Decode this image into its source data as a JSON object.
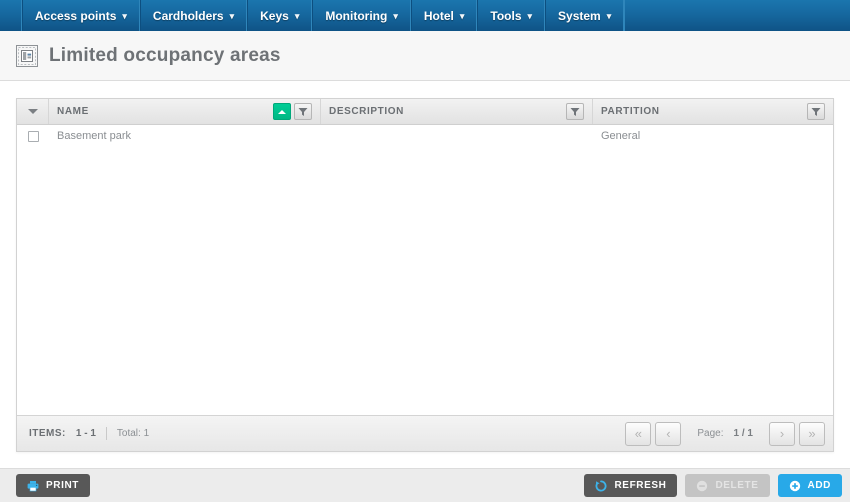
{
  "nav": {
    "items": [
      {
        "label": "Access points",
        "caret": "chevron-down-icon"
      },
      {
        "label": "Cardholders",
        "caret": "chevron-down-icon"
      },
      {
        "label": "Keys",
        "caret": "chevron-down-icon"
      },
      {
        "label": "Monitoring",
        "caret": "chevron-down-icon"
      },
      {
        "label": "Hotel",
        "caret": "chevron-down-icon"
      },
      {
        "label": "Tools",
        "caret": "chevron-down-icon"
      },
      {
        "label": "System",
        "caret": "chevron-down-icon"
      }
    ],
    "caret_glyph": "▾"
  },
  "header": {
    "title": "Limited occupancy areas",
    "icon": "limited-occupancy-area-icon"
  },
  "grid": {
    "columns": [
      {
        "key": "select",
        "label": "",
        "icon": "chevron-down-icon"
      },
      {
        "key": "name",
        "label": "NAME",
        "sorted": true,
        "sort_direction": "asc",
        "filter_icon": "funnel-icon"
      },
      {
        "key": "description",
        "label": "DESCRIPTION",
        "sorted": false,
        "filter_icon": "funnel-icon"
      },
      {
        "key": "partition",
        "label": "PARTITION",
        "sorted": false,
        "filter_icon": "funnel-icon"
      }
    ],
    "rows": [
      {
        "selected": false,
        "name": "Basement park",
        "description": "",
        "partition": "General"
      }
    ],
    "footer": {
      "items_label": "ITEMS:",
      "items_range": "1 - 1",
      "total_label": "Total: 1",
      "page_label": "Page:",
      "page_value": "1 / 1",
      "first_glyph": "«",
      "prev_glyph": "‹",
      "next_glyph": "›",
      "last_glyph": "»"
    }
  },
  "toolbar": {
    "print_label": "PRINT",
    "print_icon": "printer-icon",
    "refresh_label": "REFRESH",
    "refresh_icon": "refresh-icon",
    "delete_label": "DELETE",
    "delete_icon": "minus-circle-icon",
    "delete_disabled": true,
    "add_label": "ADD",
    "add_icon": "plus-circle-icon"
  },
  "colors": {
    "nav_blue": "#16689f",
    "accent_blue": "#28a9e8",
    "sort_green": "#00c48c",
    "dark_button": "#585858",
    "disabled_gray": "#c4c4c4",
    "title_text": "#6e7276",
    "page_bg": "#ffffff",
    "toolbar_bg": "#ececec"
  }
}
